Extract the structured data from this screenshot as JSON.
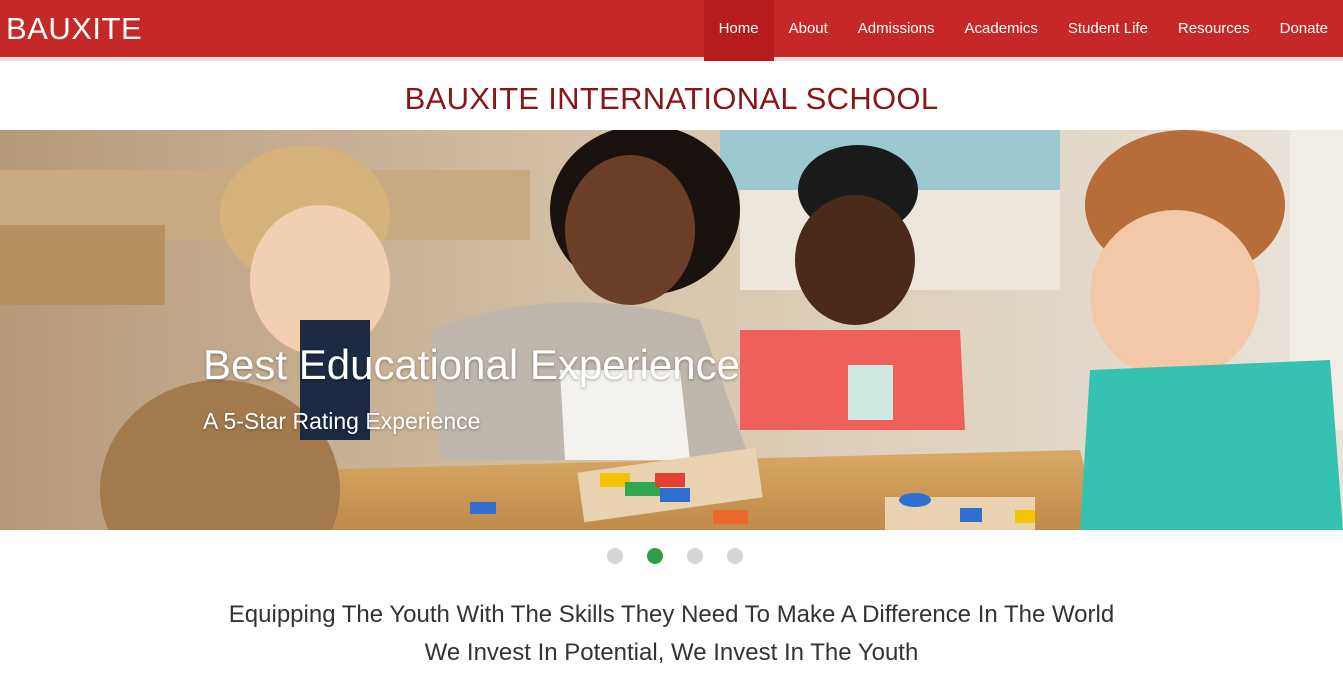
{
  "brand": "BAUXITE",
  "nav": {
    "items": [
      {
        "label": "Home",
        "active": true
      },
      {
        "label": "About"
      },
      {
        "label": "Admissions"
      },
      {
        "label": "Academics"
      },
      {
        "label": "Student Life"
      },
      {
        "label": "Resources"
      },
      {
        "label": "Donate"
      }
    ]
  },
  "page_title": "BAUXITE INTERNATIONAL SCHOOL",
  "hero": {
    "heading": "Best Educational Experience",
    "subheading": "A 5-Star Rating Experience"
  },
  "carousel": {
    "slide_count": 4,
    "active_slide": 2
  },
  "tagline": {
    "line1": "Equipping The Youth With The Skills They Need To Make A Difference In The World",
    "line2": "We Invest In Potential, We Invest In The Youth"
  },
  "colors": {
    "brand_red": "#c62828",
    "title_red": "#8b1414",
    "active_dot": "#2e9e48",
    "inactive_dot": "#d6d6d6"
  }
}
